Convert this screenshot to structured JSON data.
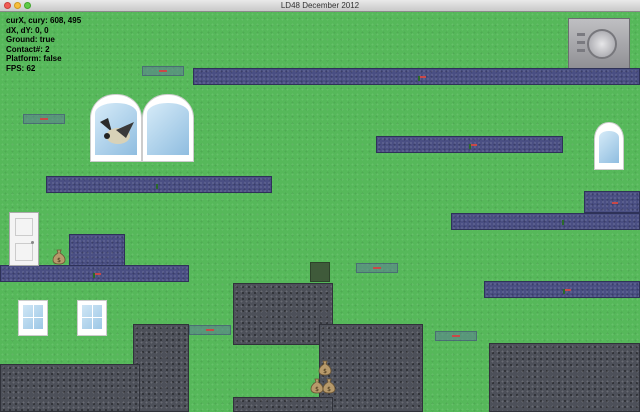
{
  "window": {
    "title": "LD48 December 2012"
  },
  "debug": {
    "cur": "curX, cury:  608, 495",
    "delta": "dX, dY: 0, 0",
    "ground": "Ground: true",
    "contact": "Contact#: 2",
    "platform": "Platform: false",
    "fps": "FPS: 62"
  },
  "scene": {
    "background_color": "#56b85a",
    "platform_color": "#4a4f83",
    "rock_color": "#4d5059",
    "objects": [
      "money-bag",
      "money-bag-pile",
      "vault",
      "door",
      "arched-window",
      "small-window",
      "bird"
    ]
  }
}
